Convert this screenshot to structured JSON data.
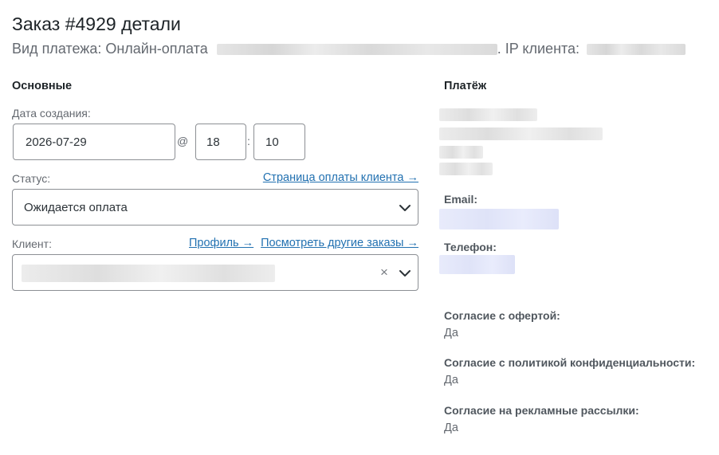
{
  "header": {
    "title": "Заказ #4929 детали",
    "payment_method_label": "Вид платежа: Онлайн-оплата",
    "ip_label": ". IP клиента:"
  },
  "general": {
    "heading": "Основные",
    "date_label": "Дата создания:",
    "date_value": "2026-07-29",
    "at_sign": "@",
    "hour_value": "18",
    "time_colon": ":",
    "minute_value": "10",
    "status_label": "Статус:",
    "payment_page_link": "Страница оплаты клиента →",
    "status_value": "Ожидается оплата",
    "client_label": "Клиент:",
    "profile_link": "Профиль →",
    "other_orders_link": "Посмотреть другие заказы →",
    "clear_glyph": "×"
  },
  "payment": {
    "heading": "Платёж",
    "email_label": "Email:",
    "phone_label": "Телефон:",
    "offer_consent_label": "Согласие с офертой:",
    "offer_consent_value": "Да",
    "privacy_consent_label": "Согласие с политикой конфиденциальности:",
    "privacy_consent_value": "Да",
    "marketing_consent_label": "Согласие на рекламные рассылки:",
    "marketing_consent_value": "Да"
  },
  "icons": {
    "status_dropdown": "chevron-down-icon",
    "client_dropdown": "chevron-down-icon",
    "client_clear": "close-icon"
  },
  "colors": {
    "link": "#2271b1",
    "text": "#1d2327",
    "muted": "#646970",
    "border": "#8c8f94"
  }
}
